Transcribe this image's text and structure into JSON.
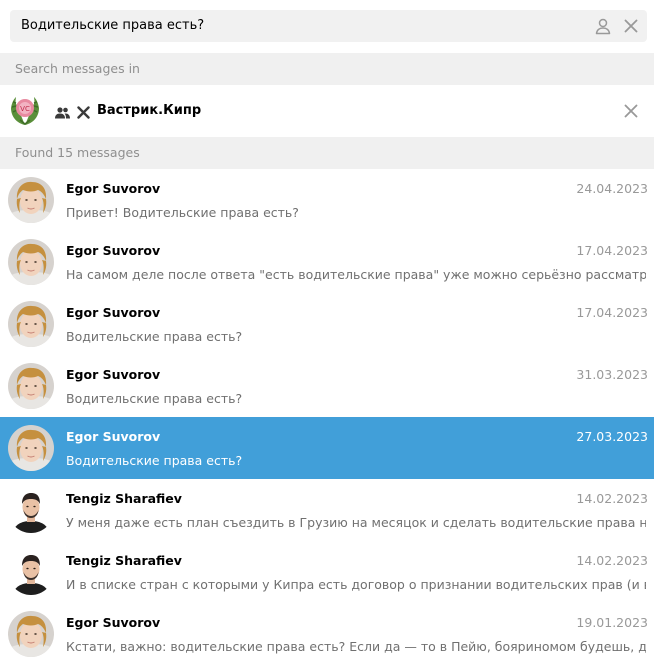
{
  "search": {
    "query": "Водительские права есть?",
    "icons": [
      "person-icon",
      "close-icon"
    ]
  },
  "search_in": {
    "label": "Search messages in"
  },
  "chat": {
    "name": "Вастрик.Кипр",
    "icons": [
      "chat-logo",
      "group-icon",
      "x-icon",
      "close-icon"
    ]
  },
  "results": {
    "header": "Found 15 messages",
    "items": [
      {
        "sender": "Egor Suvorov",
        "date": "24.04.2023",
        "text": "Привет! Водительские права есть?",
        "avatar": "egor"
      },
      {
        "sender": "Egor Suvorov",
        "date": "17.04.2023",
        "text": "На самом деле после ответа \"есть водительские права\" уже можно серьёзно рассматривать...",
        "avatar": "egor"
      },
      {
        "sender": "Egor Suvorov",
        "date": "17.04.2023",
        "text": "Водительские права есть?",
        "avatar": "egor"
      },
      {
        "sender": "Egor Suvorov",
        "date": "31.03.2023",
        "text": "Водительские права есть?",
        "avatar": "egor"
      },
      {
        "sender": "Egor Suvorov",
        "date": "27.03.2023",
        "text": "Водительские права есть?",
        "avatar": "egor",
        "selected": true
      },
      {
        "sender": "Tengiz Sharafiev",
        "date": "14.02.2023",
        "text": "У меня даже есть план съездить в Грузию на месяцок и сделать водительские права на кат. В",
        "avatar": "tengiz"
      },
      {
        "sender": "Tengiz Sharafiev",
        "date": "14.02.2023",
        "text": "И в списке стран с которыми у Кипра есть договор о признании водительских прав (и возм...",
        "avatar": "tengiz"
      },
      {
        "sender": "Egor Suvorov",
        "date": "19.01.2023",
        "text": "Кстати, важно: водительские права есть? Если да — то в Пейю, бояриномом будешь, дёшево с...",
        "avatar": "egor"
      }
    ]
  },
  "colors": {
    "selected": "#419fd9",
    "header_bg": "#f0f0f0",
    "muted": "#8f8f8f"
  }
}
